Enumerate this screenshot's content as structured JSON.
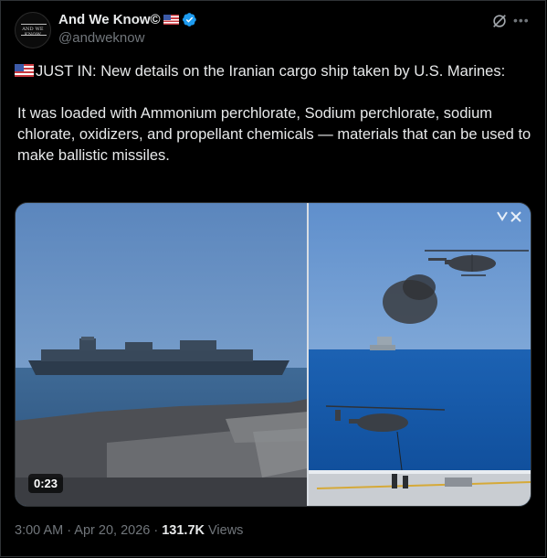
{
  "tweet": {
    "author": {
      "display_name": "And We Know©",
      "handle": "@andweknow",
      "verified": true,
      "avatar_label": "AND WE KNOW",
      "name_flag_icon": "us-flag-icon"
    },
    "header_icons": [
      "grok-icon",
      "more-icon"
    ],
    "text_line1": "JUST IN: New details on the Iranian cargo ship taken by U.S. Marines:",
    "text_line2": "It was loaded with Ammonium perchlorate, Sodium perchlorate, sodium chlorate, oxidizers, and propellant chemicals — materials that can be used to make ballistic missiles.",
    "media": {
      "type": "video",
      "duration": "0:23",
      "watermark_icon": "source-logo-icon"
    },
    "timestamp": "3:00 AM · Apr 20, 2026",
    "views_count": "131.7K",
    "views_label": "Views"
  },
  "colors": {
    "background": "#000000",
    "text": "#e7e9ea",
    "secondary": "#71767b",
    "verified": "#1d9bf0",
    "border": "#2f3336"
  }
}
